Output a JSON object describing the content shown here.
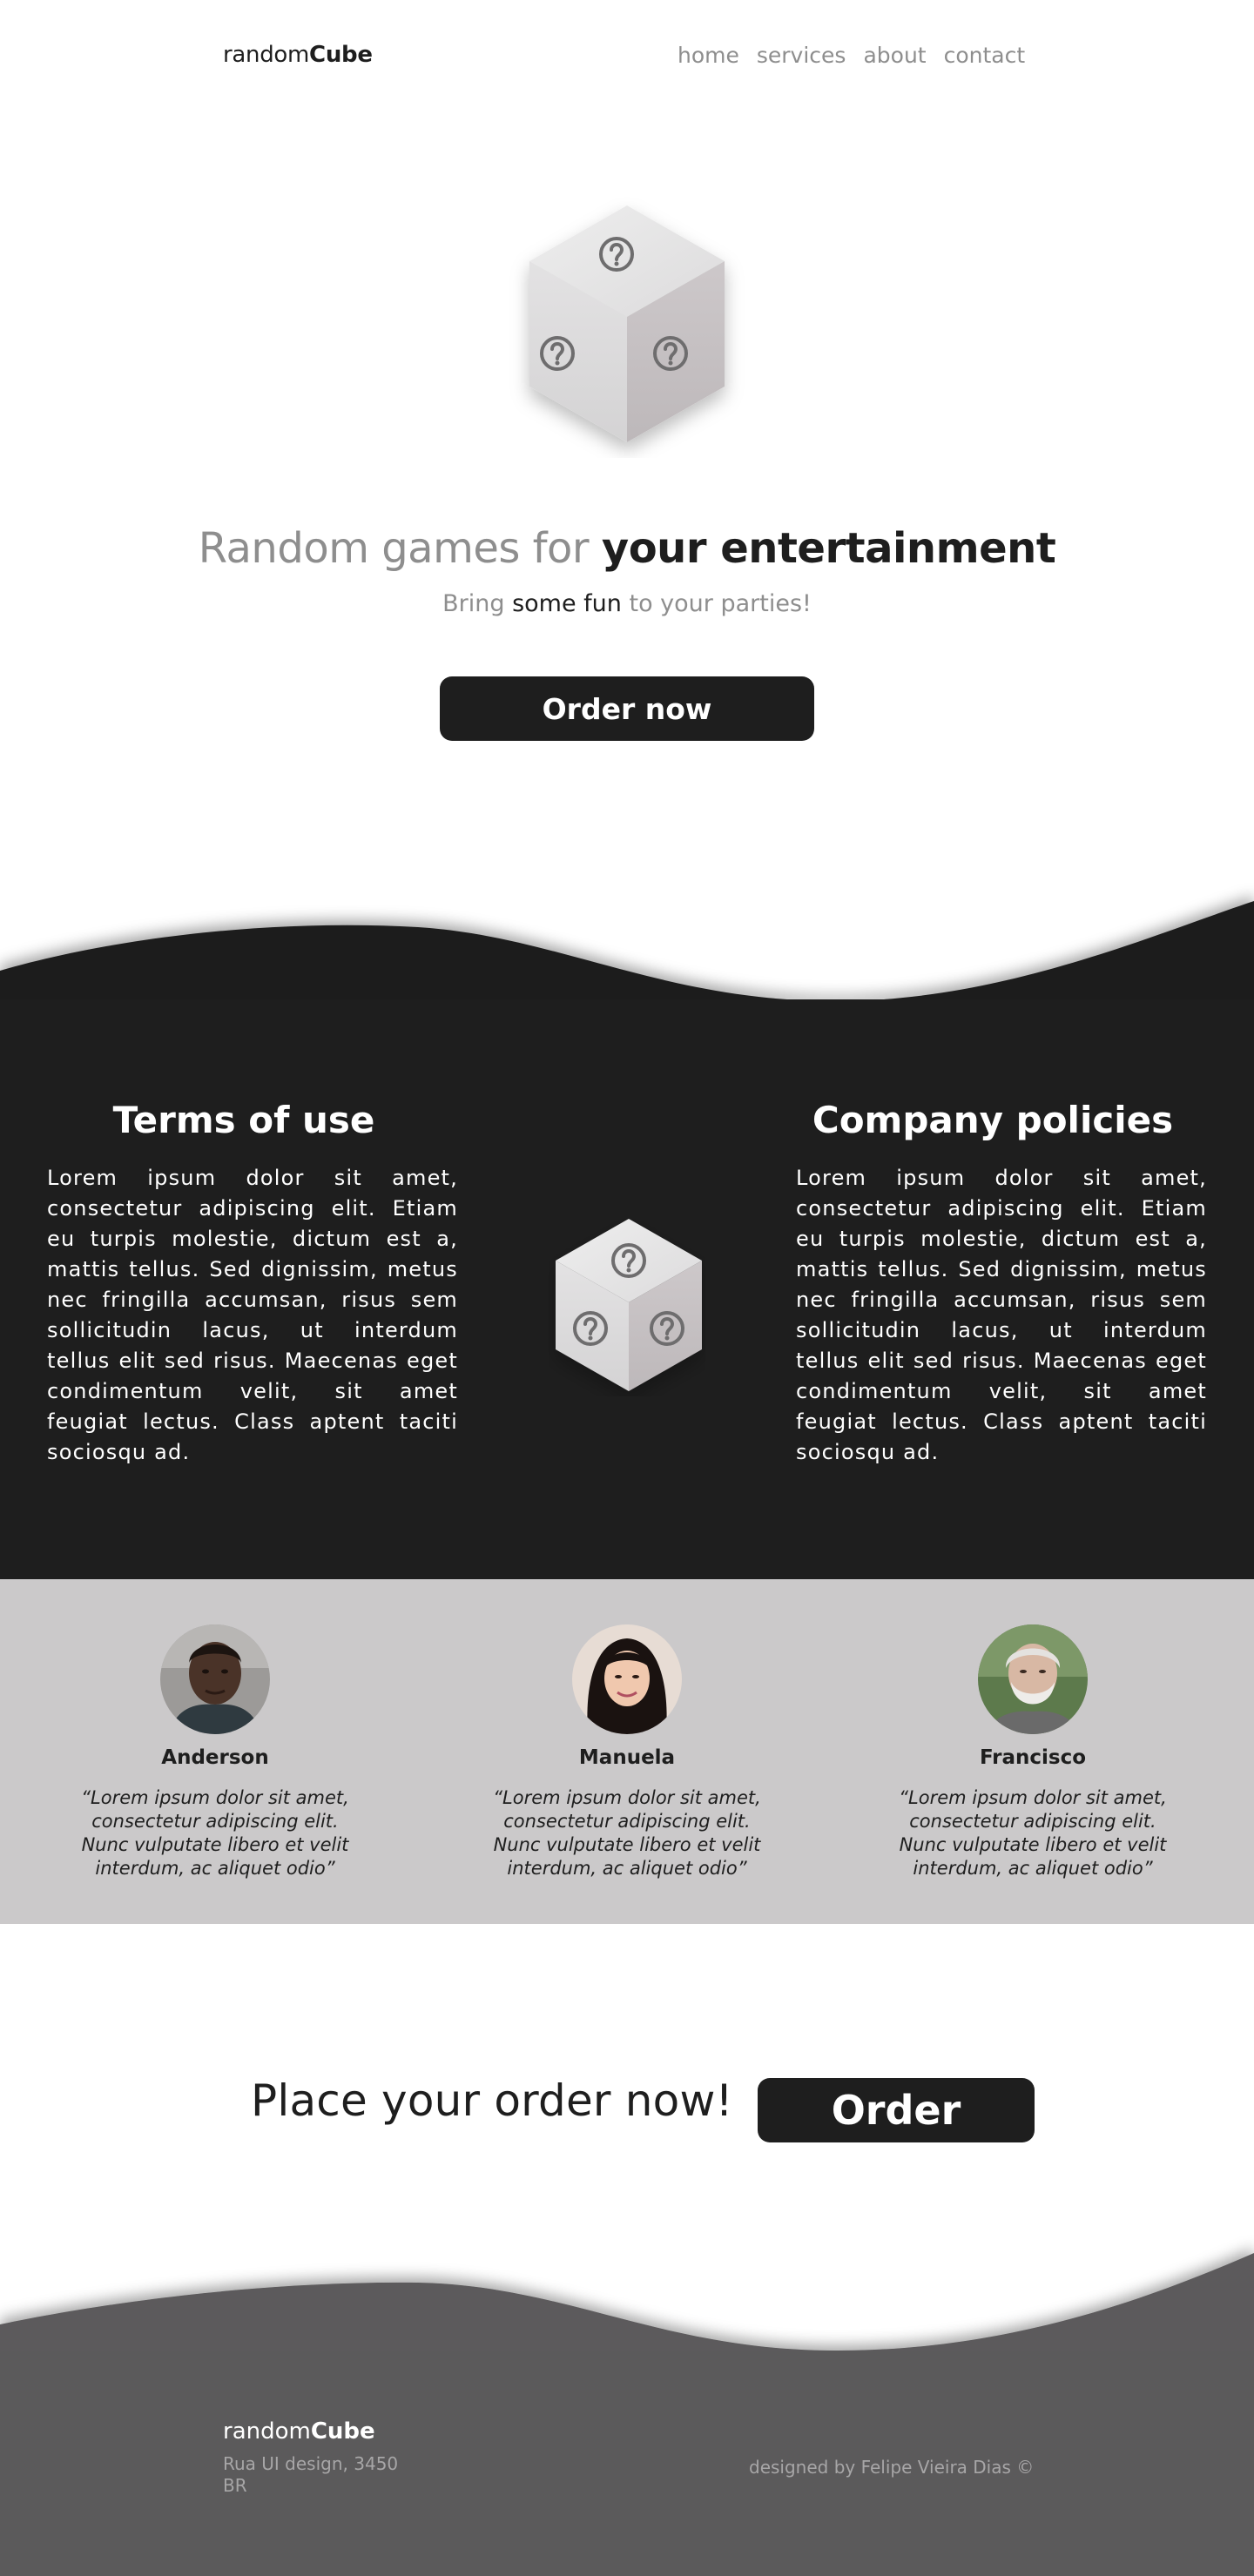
{
  "header": {
    "brand_light": "random",
    "brand_bold": "Cube",
    "nav": [
      "home",
      "services",
      "about",
      "contact"
    ]
  },
  "hero": {
    "title_light": "Random games for ",
    "title_bold": "your entertainment",
    "subtitle_pre": "Bring ",
    "subtitle_em": "some fun",
    "subtitle_post": " to your parties!",
    "button_label": "Order now",
    "cube_icon": "question-mark-icon"
  },
  "info": {
    "terms_title": "Terms of use",
    "terms_text": "Lorem ipsum dolor sit amet, consectetur adipiscing elit. Etiam eu turpis molestie, dictum est a, mattis tellus. Sed dignissim, metus nec fringilla accumsan, risus sem sollicitudin lacus, ut interdum tellus elit sed risus. Maecenas eget condimentum velit, sit amet feugiat lectus. Class aptent taciti sociosqu ad.",
    "policies_title": "Company policies",
    "policies_text": "Lorem ipsum dolor sit amet, consectetur adipiscing elit. Etiam eu turpis molestie, dictum est a, mattis tellus. Sed dignissim, metus nec fringilla accumsan, risus sem sollicitudin lacus, ut interdum tellus elit sed risus. Maecenas eget condimentum velit, sit amet feugiat lectus. Class aptent taciti sociosqu ad."
  },
  "testimonials": [
    {
      "name": "Anderson",
      "quote": "“Lorem ipsum dolor sit amet, consectetur adipiscing elit. Nunc vulputate libero et velit interdum, ac aliquet odio”"
    },
    {
      "name": "Manuela",
      "quote": "“Lorem ipsum dolor sit amet, consectetur adipiscing elit. Nunc vulputate libero et velit interdum, ac aliquet odio”"
    },
    {
      "name": "Francisco",
      "quote": "“Lorem ipsum dolor sit amet, consectetur adipiscing elit. Nunc vulputate libero et velit interdum, ac aliquet odio”"
    }
  ],
  "cta": {
    "text": "Place your order now!",
    "button_label": "Order"
  },
  "footer": {
    "brand_light": "random",
    "brand_bold": "Cube",
    "address_line1": "Rua UI design, 3450",
    "address_line2": "BR",
    "credit": "designed by Felipe Vieira Dias ©"
  },
  "colors": {
    "dark": "#1e1e1e",
    "gray_text": "#8e8e8e",
    "testimonial_bg": "#cbc9ca",
    "footer_bg": "#5b5a5b"
  }
}
